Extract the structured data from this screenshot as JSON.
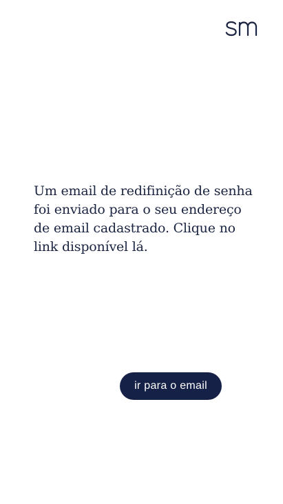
{
  "header": {
    "logo_text": "sm",
    "logo_color": "#1a2340"
  },
  "main": {
    "message": "Um email de redifinição de senha foi enviado para o seu endereço de email cadastrado. Clique no link disponível lá.",
    "button_label": "ir para o email",
    "button_color": "#152146",
    "text_color": "#1a2340"
  }
}
